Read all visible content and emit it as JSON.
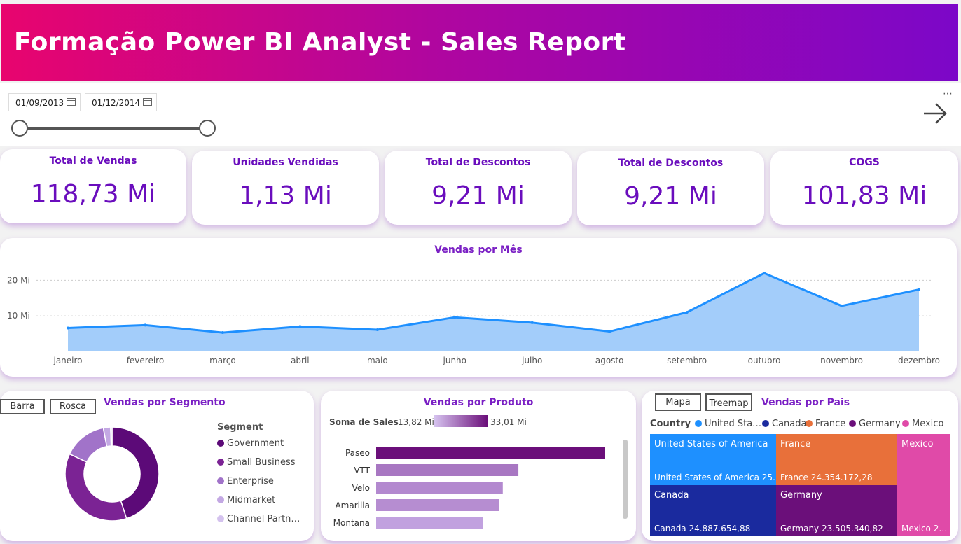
{
  "header": {
    "title": "Formação Power BI Analyst - Sales Report"
  },
  "filters": {
    "start_date": "01/09/2013",
    "end_date": "01/12/2014",
    "range_start": 0.0,
    "range_end": 1.0
  },
  "kpis": [
    {
      "title": "Total de Vendas",
      "value": "118,73 Mi"
    },
    {
      "title": "Unidades Vendidas",
      "value": "1,13 Mi"
    },
    {
      "title": "Total de Descontos",
      "value": "9,21 Mi"
    },
    {
      "title": "Total de Descontos",
      "value": "9,21 Mi"
    },
    {
      "title": "COGS",
      "value": "101,83 Mi"
    }
  ],
  "line_chart": {
    "title": "Vendas por Mês",
    "y_ticks": [
      "20 Mi",
      "10 Mi"
    ]
  },
  "segment": {
    "title": "Vendas por Segmento",
    "tab_bar": "Barra",
    "tab_donut": "Rosca",
    "legend_title": "Segment",
    "items": [
      {
        "label": "Government",
        "color": "#5c0a78"
      },
      {
        "label": "Small Business",
        "color": "#7b2394"
      },
      {
        "label": "Enterprise",
        "color": "#a173c9"
      },
      {
        "label": "Midmarket",
        "color": "#c3a8e3"
      },
      {
        "label": "Channel Partn…",
        "color": "#d4c2ee"
      }
    ]
  },
  "product": {
    "title": "Vendas por Produto",
    "legend_title": "Soma de  Sales",
    "legend_min": "13,82 Mi",
    "legend_max": "33,01 Mi"
  },
  "country": {
    "title": "Vendas por Pais",
    "tab_map": "Mapa",
    "tab_treemap": "Treemap",
    "legend_title": "Country",
    "legend": [
      {
        "label": "United Sta…",
        "color": "#1e90ff"
      },
      {
        "label": "Canada",
        "color": "#1a2a9e"
      },
      {
        "label": "France",
        "color": "#e8703a"
      },
      {
        "label": "Germany",
        "color": "#6b0f7a"
      },
      {
        "label": "Mexico",
        "color": "#e04aa8"
      }
    ],
    "cells": [
      {
        "name": "United States of America",
        "value": "United States of America 25…",
        "color": "#1e90ff"
      },
      {
        "name": "France",
        "value": "France 24.354.172,28",
        "color": "#e8703a"
      },
      {
        "name": "Mexico",
        "value": "Mexico 2…",
        "color": "#e04aa8"
      },
      {
        "name": "Canada",
        "value": "Canada 24.887.654,88",
        "color": "#1a2a9e"
      },
      {
        "name": "Germany",
        "value": "Germany 23.505.340,82",
        "color": "#6b0f7a"
      }
    ]
  },
  "chart_data": [
    {
      "type": "area",
      "title": "Vendas por Mês",
      "xlabel": "",
      "ylabel": "",
      "categories": [
        "janeiro",
        "fevereiro",
        "março",
        "abril",
        "maio",
        "junho",
        "julho",
        "agosto",
        "setembro",
        "outubro",
        "novembro",
        "dezembro"
      ],
      "values": [
        6.6,
        7.4,
        5.3,
        7.0,
        6.1,
        9.6,
        8.1,
        5.6,
        11.0,
        22.0,
        12.8,
        17.4
      ],
      "unit": "Mi",
      "y_ticks": [
        10,
        20
      ],
      "ylim": [
        0,
        24
      ],
      "color": "#1e90ff",
      "fill": "#a3cdfa",
      "grid": true
    },
    {
      "type": "pie",
      "title": "Vendas por Segmento",
      "donut": true,
      "categories": [
        "Government",
        "Small Business",
        "Enterprise",
        "Midmarket",
        "Channel Partn…"
      ],
      "values": [
        45,
        37,
        15,
        2.5,
        0.5
      ],
      "unit": "%"
    },
    {
      "type": "bar",
      "orientation": "horizontal",
      "title": "Vendas por Produto",
      "categories": [
        "Paseo",
        "VTT",
        "Velo",
        "Amarilla",
        "Montana"
      ],
      "values": [
        33.01,
        20.5,
        18.25,
        17.75,
        15.4
      ],
      "unit": "Mi",
      "color_scale": [
        "#c9aee8",
        "#6b0f7a"
      ],
      "color_range": [
        13.82,
        33.01
      ]
    },
    {
      "type": "treemap",
      "title": "Vendas por Pais",
      "categories": [
        "United States of America",
        "France",
        "Mexico",
        "Canada",
        "Germany"
      ],
      "values": [
        25000000,
        24354172.28,
        20000000,
        24887654.88,
        23505340.82
      ]
    }
  ]
}
